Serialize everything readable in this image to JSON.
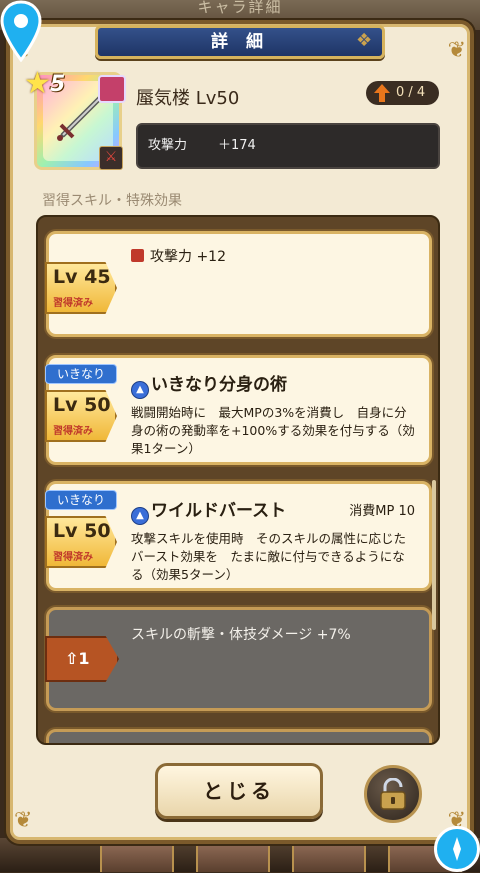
{
  "backdrop": {
    "title": "キャラ詳細"
  },
  "header": {
    "title": "詳 細"
  },
  "item": {
    "rarity": "5",
    "name": "蜃気楼 Lv50",
    "upgrade": "0 / 4",
    "stat_label": "攻撃力",
    "stat_value": "＋174"
  },
  "section_label": "習得スキル・特殊効果",
  "skills": [
    {
      "level": "Lv 45",
      "status": "習得済み",
      "title": "攻撃力 +12"
    },
    {
      "tag": "いきなり",
      "level": "Lv 50",
      "status": "習得済み",
      "title": "いきなり分身の術",
      "desc": "戦闘開始時に　最大MPの3%を消費し　自身に分身の術の発動率を+100%する効果を付与する（効果1ターン）"
    },
    {
      "tag": "いきなり",
      "level": "Lv 50",
      "status": "習得済み",
      "title": "ワイルドバースト",
      "mp": "消費MP 10",
      "desc": "攻撃スキルを使用時　そのスキルの属性に応じたバースト効果を　たまに敵に付与できるようになる（効果5ターン）"
    },
    {
      "level": "1",
      "title": "スキルの斬撃・体技ダメージ +7%"
    }
  ],
  "buttons": {
    "close": "とじる"
  },
  "colors": {
    "accent": "#2f6fce",
    "frame": "#d9b364",
    "locked": "#6b6864"
  }
}
